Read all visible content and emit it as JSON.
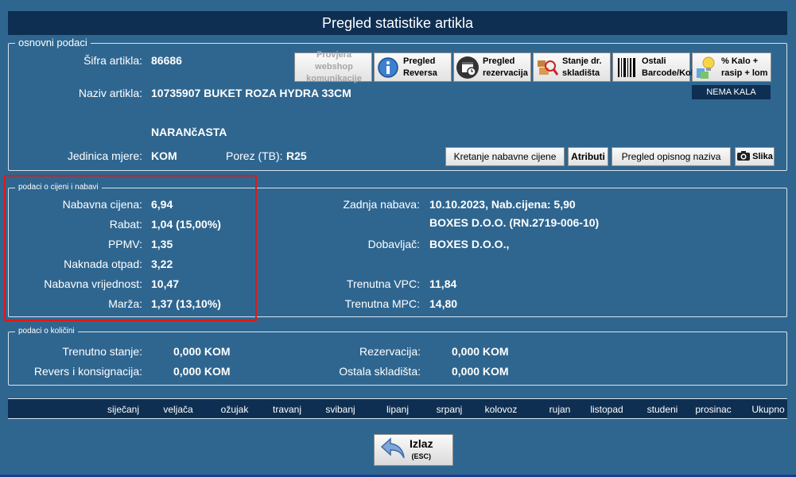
{
  "window": {
    "title": "Pregled statistike artikla"
  },
  "osnovni": {
    "legend": "osnovni podaci",
    "sifra_label": "Šifra artikla:",
    "sifra_value": "86686",
    "naziv_label": "Naziv artikla:",
    "naziv_value_line1": "10735907 BUKET ROZA HYDRA 33CM",
    "naziv_value_line2": "NARANčASTA",
    "jedinica_label": "Jedinica mjere:",
    "jedinica_value": "KOM",
    "porez_label": "Porez (TB):",
    "porez_value": "R25",
    "nema_kala": "NEMA KALA"
  },
  "toolbar": {
    "webshop_line1": "Provjera webshop",
    "webshop_line2": "komunikacije",
    "reversa_line1": "Pregled",
    "reversa_line2": "Reversa",
    "rezervacije_line1": "Pregled",
    "rezervacije_line2": "rezervacija",
    "stanje_line1": "Stanje dr.",
    "stanje_line2": "skladišta",
    "barcode_line1": "Ostali",
    "barcode_line2": "Barcode/Kol",
    "kalo_line1": "% Kalo +",
    "kalo_line2": "rasip + lom",
    "kretanje": "Kretanje nabavne cijene",
    "atributi": "Atributi",
    "opis": "Pregled opisnog naziva",
    "slika": "Slika"
  },
  "cijene": {
    "legend": "podaci o cijeni i nabavi",
    "nabavna_cijena_label": "Nabavna cijena:",
    "nabavna_cijena_value": "6,94",
    "rabat_label": "Rabat:",
    "rabat_value": "1,04 (15,00%)",
    "ppmv_label": "PPMV:",
    "ppmv_value": "1,35",
    "naknada_label": "Naknada otpad:",
    "naknada_value": "3,22",
    "nabavna_vrijednost_label": "Nabavna vrijednost:",
    "nabavna_vrijednost_value": "10,47",
    "marza_label": "Marža:",
    "marza_value": "1,37 (13,10%)",
    "zadnja_label": "Zadnja nabava:",
    "zadnja_value_line1": "10.10.2023,  Nab.cijena: 5,90",
    "zadnja_value_line2": "BOXES D.O.O. (RN.2719-006-10)",
    "dobavljac_label": "Dobavljač:",
    "dobavljac_value": "BOXES D.O.O.,",
    "vpc_label": "Trenutna VPC:",
    "vpc_value": "11,84",
    "mpc_label": "Trenutna MPC:",
    "mpc_value": "14,80"
  },
  "kolicine": {
    "legend": "podaci o količini",
    "stanje_label": "Trenutno stanje:",
    "stanje_value": "0,000 KOM",
    "revers_label": "Revers i konsignacija:",
    "revers_value": "0,000 KOM",
    "rezervacija_label": "Rezervacija:",
    "rezervacija_value": "0,000 KOM",
    "ostala_label": "Ostala skladišta:",
    "ostala_value": "0,000 KOM"
  },
  "months": [
    "siječanj",
    "veljača",
    "ožujak",
    "travanj",
    "svibanj",
    "lipanj",
    "srpanj",
    "kolovoz",
    "rujan",
    "listopad",
    "studeni",
    "prosinac",
    "Ukupno"
  ],
  "izlaz": {
    "label": "Izlaz",
    "hint": "(ESC)"
  }
}
